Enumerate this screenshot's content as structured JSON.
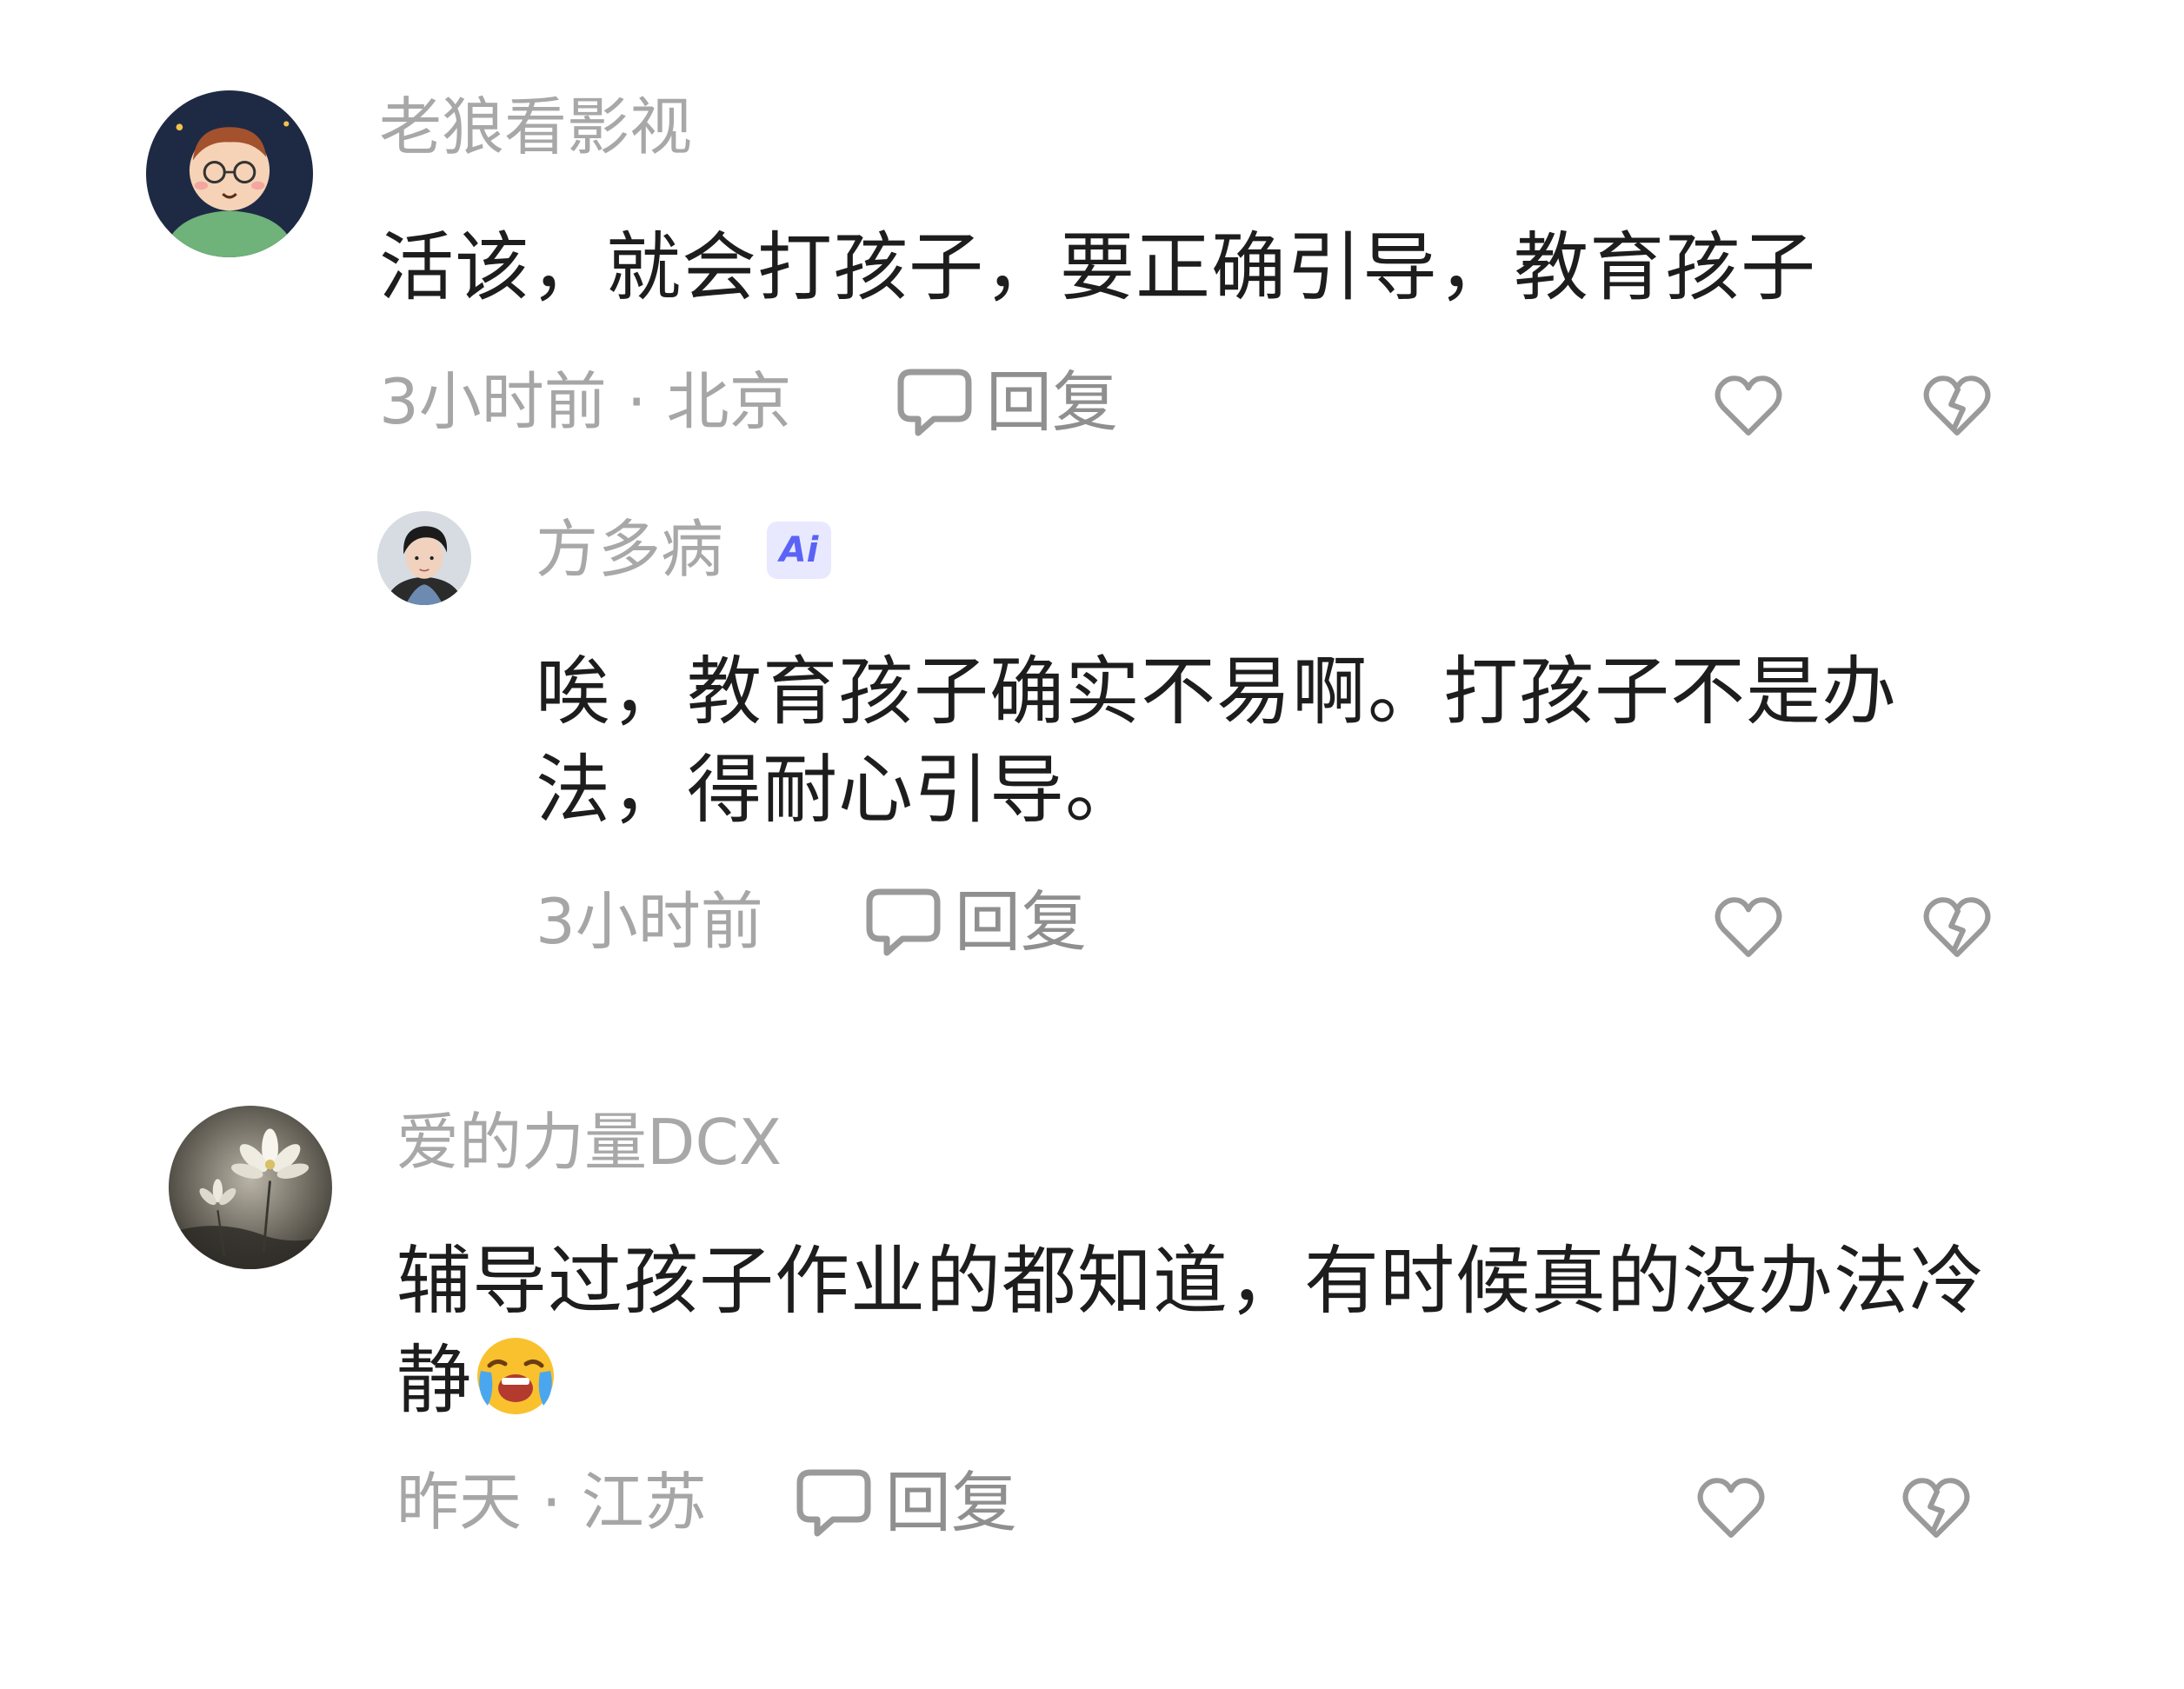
{
  "comments": [
    {
      "username": "老狼看影视",
      "text": "活该，就会打孩子，要正确引导，教育孩子",
      "meta": "3小时前 · 北京",
      "reply_label": "回复",
      "avatar_icon": "cartoon-avatar",
      "replies": [
        {
          "username": "方多病",
          "badge": "Ai",
          "text": "唉，教育孩子确实不易啊。打孩子不是办法，得耐心引导。",
          "meta": "3小时前",
          "reply_label": "回复",
          "avatar_icon": "portrait-avatar"
        }
      ]
    },
    {
      "username": "爱的力量DCX",
      "text": "辅导过孩子作业的都知道，有时候真的没办法冷静",
      "emoji": "loudly-crying-face",
      "meta": "昨天 · 江苏",
      "reply_label": "回复",
      "avatar_icon": "lotus-painting-avatar"
    }
  ],
  "colors": {
    "username": "#a8a8a8",
    "body_text": "#1d1d1d",
    "meta": "#a6a6a6",
    "icon": "#9a9a9a",
    "ai_badge_bg": "#e8e9ff",
    "ai_badge_text": "#5a63f5"
  }
}
